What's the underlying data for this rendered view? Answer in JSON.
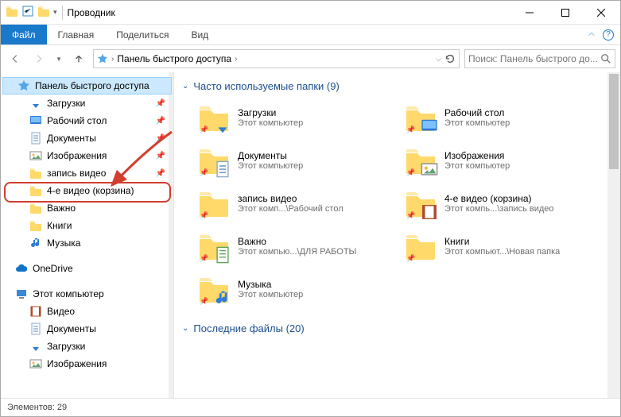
{
  "window": {
    "title": "Проводник"
  },
  "ribbon": {
    "file": "Файл",
    "tabs": [
      "Главная",
      "Поделиться",
      "Вид"
    ]
  },
  "address": {
    "crumb": "Панель быстрого доступа",
    "search_placeholder": "Поиск: Панель быстрого до..."
  },
  "tree": {
    "quick_access": "Панель быстрого доступа",
    "items": [
      {
        "label": "Загрузки",
        "pinned": true,
        "icon": "downloads"
      },
      {
        "label": "Рабочий стол",
        "pinned": true,
        "icon": "desktop"
      },
      {
        "label": "Документы",
        "pinned": true,
        "icon": "documents"
      },
      {
        "label": "Изображения",
        "pinned": true,
        "icon": "pictures"
      },
      {
        "label": "запись видео",
        "pinned": true,
        "icon": "folder"
      },
      {
        "label": "4-е видео (корзина)",
        "pinned": false,
        "icon": "folder"
      },
      {
        "label": "Важно",
        "pinned": false,
        "icon": "folder"
      },
      {
        "label": "Книги",
        "pinned": false,
        "icon": "folder"
      },
      {
        "label": "Музыка",
        "pinned": false,
        "icon": "music"
      }
    ],
    "onedrive": "OneDrive",
    "this_pc": "Этот компьютер",
    "pc_items": [
      {
        "label": "Видео",
        "icon": "videos"
      },
      {
        "label": "Документы",
        "icon": "documents"
      },
      {
        "label": "Загрузки",
        "icon": "downloads"
      },
      {
        "label": "Изображения",
        "icon": "pictures"
      }
    ]
  },
  "content": {
    "section1_title": "Часто используемые папки (9)",
    "section2_title": "Последние файлы (20)",
    "folders": [
      {
        "name": "Загрузки",
        "sub": "Этот компьютер",
        "overlay": "down-arrow"
      },
      {
        "name": "Рабочий стол",
        "sub": "Этот компьютер",
        "overlay": "desktop"
      },
      {
        "name": "Документы",
        "sub": "Этот компьютер",
        "overlay": "doc"
      },
      {
        "name": "Изображения",
        "sub": "Этот компьютер",
        "overlay": "pic"
      },
      {
        "name": "запись видео",
        "sub": "Этот комп...\\Рабочий стол",
        "overlay": ""
      },
      {
        "name": "4-е видео (корзина)",
        "sub": "Этот компь...\\запись видео",
        "overlay": "video"
      },
      {
        "name": "Важно",
        "sub": "Этот компью...\\ДЛЯ РАБОТЫ",
        "overlay": "sheet"
      },
      {
        "name": "Книги",
        "sub": "Этот компьют...\\Новая папка",
        "overlay": ""
      },
      {
        "name": "Музыка",
        "sub": "Этот компьютер",
        "overlay": "music"
      }
    ]
  },
  "status": {
    "elements": "Элементов: 29"
  }
}
